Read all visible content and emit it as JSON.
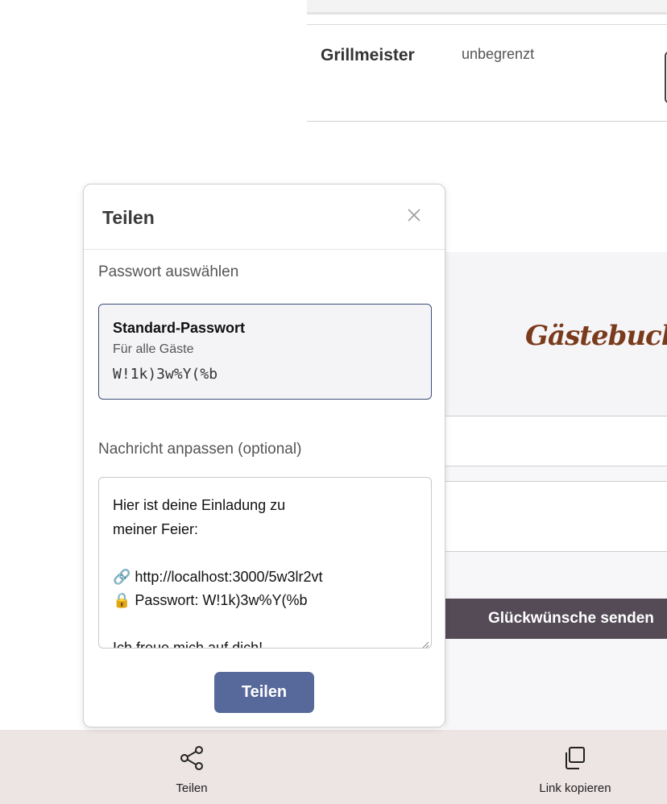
{
  "background": {
    "row": {
      "name": "Grillmeister",
      "duration": "unbegrenzt"
    },
    "guestbook": {
      "title": "Gästebuch"
    },
    "send_button": "Glückwünsche senden"
  },
  "modal": {
    "title": "Teilen",
    "close_icon": "close-icon",
    "password_label": "Passwort auswählen",
    "password_option": {
      "title": "Standard-Passwort",
      "subtitle": "Für alle Gäste",
      "password": "W!1k)3w%Y(%b"
    },
    "message_label": "Nachricht anpassen (optional)",
    "message": "Hier ist deine Einladung zu\nmeiner Feier:\n\n🔗 http://localhost:3000/5w3lr2vt\n🔒 Passwort: W!1k)3w%Y(%b\n\nIch freue mich auf dich!",
    "share_button": "Teilen"
  },
  "bottom_bar": {
    "share": {
      "label": "Teilen",
      "icon": "share-icon"
    },
    "copy": {
      "label": "Link kopieren",
      "icon": "copy-icon"
    }
  },
  "colors": {
    "primary": "#57689a",
    "send_button": "#544b57",
    "guestbook_title": "#7a3b1c",
    "bottom_bar": "#ede4e4",
    "selected_border": "#3d4e7a"
  }
}
